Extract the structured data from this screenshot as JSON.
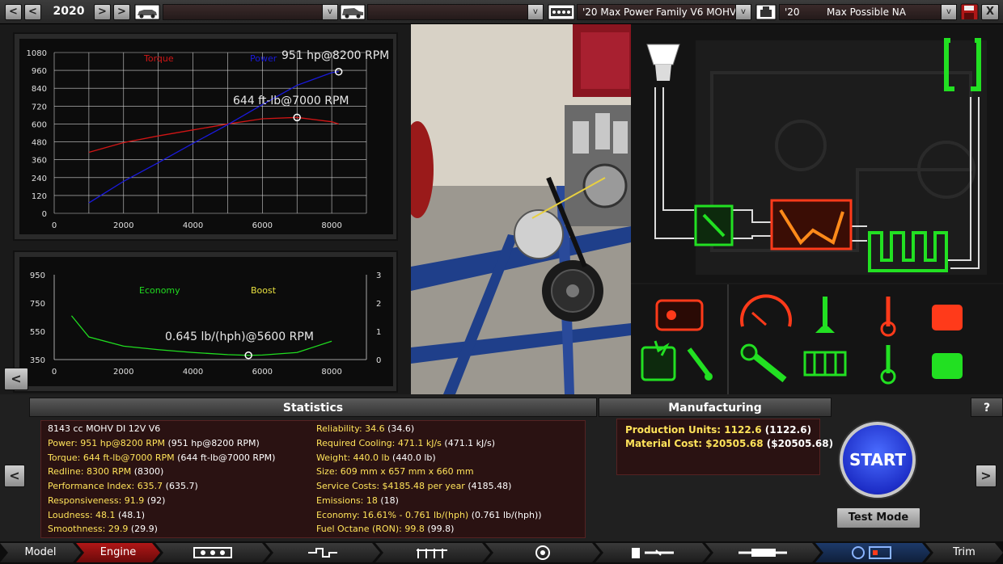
{
  "topbar": {
    "year": "2020",
    "engine_family": "'20 Max Power Family V6 MOHV",
    "variant_year": "'20",
    "variant_name": "Max Possible NA",
    "prev_label": "<",
    "prev2_label": "<",
    "next_label": ">",
    "next2_label": ">",
    "dropdown_arrow": "v",
    "close_label": "X"
  },
  "power_graph": {
    "torque_label": "Torque",
    "power_label": "Power",
    "power_peak": "951 hp@8200 RPM",
    "torque_peak": "644 ft-lb@7000 RPM",
    "y_ticks": [
      "1080",
      "960",
      "840",
      "720",
      "600",
      "480",
      "360",
      "240",
      "120",
      "0"
    ],
    "x_ticks": [
      "0",
      "2000",
      "4000",
      "6000",
      "8000"
    ],
    "colors": {
      "torque": "#d01515",
      "power": "#1a1adc"
    }
  },
  "chart_data": [
    {
      "type": "line",
      "x": [
        1000,
        2000,
        3000,
        4000,
        5000,
        6000,
        7000,
        8000,
        8200
      ],
      "series": [
        {
          "name": "Power",
          "values": [
            70,
            215,
            340,
            470,
            595,
            730,
            860,
            945,
            951
          ]
        },
        {
          "name": "Torque",
          "values": [
            410,
            475,
            520,
            560,
            600,
            635,
            644,
            615,
            600
          ]
        }
      ],
      "xlim": [
        0,
        9000
      ],
      "ylim": [
        0,
        1080
      ]
    },
    {
      "type": "line",
      "x": [
        500,
        1000,
        2000,
        3000,
        4000,
        5000,
        5600,
        6000,
        7000,
        8000
      ],
      "series": [
        {
          "name": "Economy",
          "values": [
            660,
            510,
            445,
            420,
            400,
            385,
            380,
            382,
            400,
            480
          ]
        }
      ],
      "xlim": [
        0,
        9000
      ],
      "ylim": [
        350,
        950
      ]
    }
  ],
  "eco_graph": {
    "economy_label": "Economy",
    "boost_label": "Boost",
    "economy_peak": "0.645 lb/(hph)@5600 RPM",
    "y_ticks_left": [
      "950",
      "750",
      "550",
      "350"
    ],
    "y_ticks_right": [
      "3",
      "2",
      "1",
      "0"
    ],
    "x_ticks": [
      "0",
      "2000",
      "4000",
      "6000",
      "8000"
    ],
    "colors": {
      "economy": "#20dc20",
      "boost": "#e8e040"
    }
  },
  "statistics": {
    "title": "Statistics",
    "description": "8143 cc MOHV DI 12V V6",
    "left": [
      {
        "label": "Power: 951 hp@8200 RPM",
        "value": " (951 hp@8200 RPM)"
      },
      {
        "label": "Torque: 644 ft-lb@7000 RPM",
        "value": " (644 ft-lb@7000 RPM)"
      },
      {
        "label": "Redline: 8300 RPM",
        "value": " (8300)"
      },
      {
        "label": "Performance Index: 635.7",
        "value": " (635.7)"
      },
      {
        "label": "Responsiveness: 91.9",
        "value": " (92)"
      },
      {
        "label": "Loudness: 48.1",
        "value": " (48.1)"
      },
      {
        "label": "Smoothness: 29.9",
        "value": " (29.9)"
      }
    ],
    "right": [
      {
        "label": "Reliability: 34.6",
        "value": " (34.6)"
      },
      {
        "label": "Required Cooling: 471.1 kJ/s",
        "value": " (471.1 kJ/s)"
      },
      {
        "label": "Weight: 440.0 lb",
        "value": " (440.0 lb)"
      },
      {
        "label": "Size: 609 mm x 657 mm x 660 mm",
        "value": ""
      },
      {
        "label": "Service Costs: $4185.48 per year",
        "value": " (4185.48)"
      },
      {
        "label": "Emissions: 18",
        "value": " (18)"
      },
      {
        "label": "Economy: 16.61% - 0.761 lb/(hph)",
        "value": " (0.761 lb/(hph))"
      },
      {
        "label": "Fuel Octane (RON): 99.8",
        "value": " (99.8)"
      }
    ]
  },
  "manufacturing": {
    "title": "Manufacturing",
    "help": "?",
    "production_label": "Production Units: 1122.6",
    "production_value": " (1122.6)",
    "material_label": "Material Cost: $20505.68",
    "material_value": " ($20505.68)"
  },
  "actions": {
    "start": "START",
    "test_mode": "Test Mode",
    "left_arrow": "<",
    "right_arrow": ">"
  },
  "tabs": {
    "model": "Model",
    "engine": "Engine",
    "trim": "Trim"
  }
}
